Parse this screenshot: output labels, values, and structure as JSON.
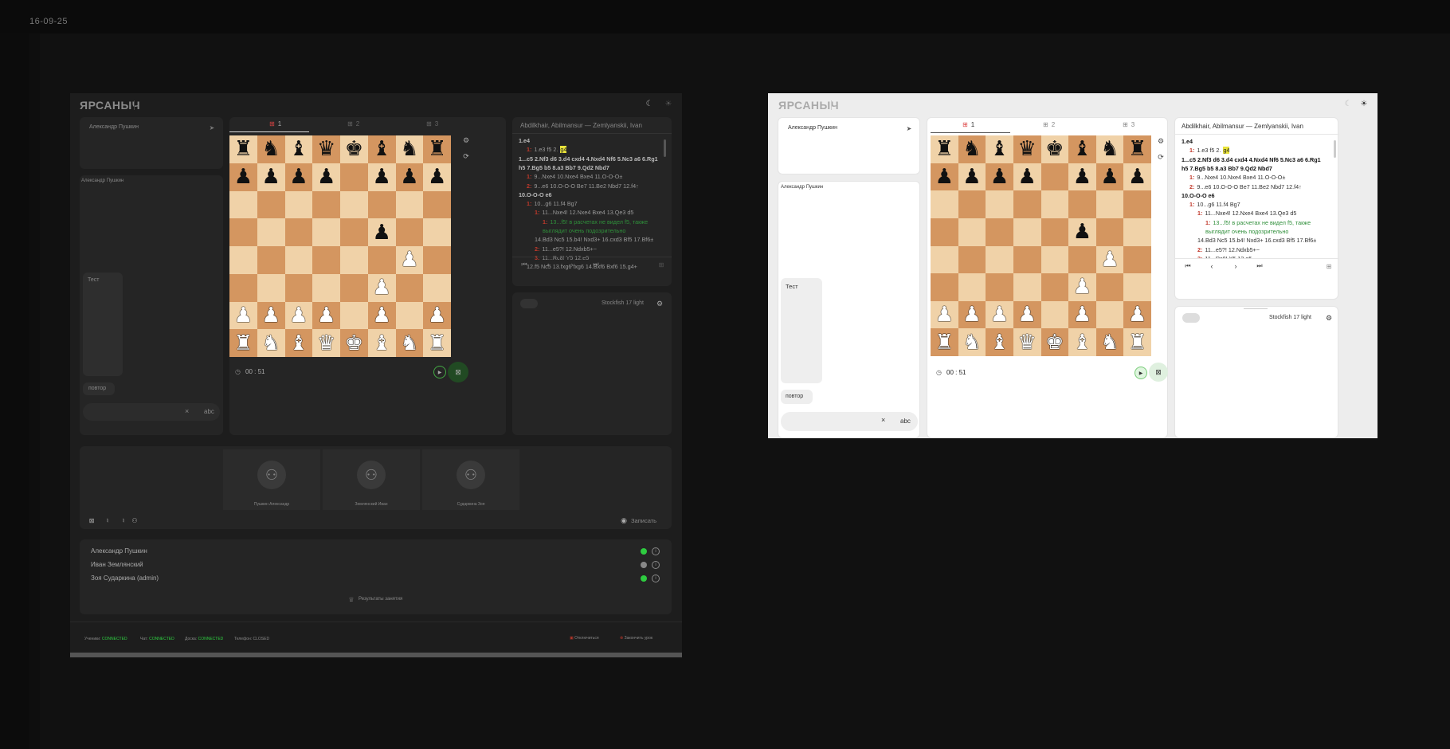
{
  "date": "16-09-25",
  "logo": "ЯРСАНЫЧ",
  "chat": {
    "sender": "Александр Пушкин",
    "author": "Александр Пушкин",
    "bubble": "Тест",
    "repeat_chip": "повтор",
    "input_placeholder": "",
    "clear_glyph": "×",
    "abc": "abc"
  },
  "board_tabs": [
    "1",
    "2",
    "3"
  ],
  "timer": "00 : 51",
  "game_title": "Abdilkhair, Abilmansur — Zemlyanskii, Ivan",
  "moves": {
    "l1": "1.e4",
    "l2a": "1:",
    "l2b": "1.e3 f5 2.",
    "l2c": "g4",
    "l3": "1...c5 2.Nf3 d6 3.d4 cxd4 4.Nxd4 Nf6 5.Nc3 a6 6.Rg1",
    "l4": "h5 7.Bg5 b5 8.a3 Bb7 9.Qd2 Nbd7",
    "l5a": "1:",
    "l5b": "9...Nxe4 10.Nxe4 Bxe4 11.O-O-O±",
    "l6a": "2:",
    "l6b": "9...e6 10.O-O-O Be7 11.Be2 Nbd7 12.f4↑",
    "l7": "10.O-O-O e6",
    "l8a": "1:",
    "l8b": "10...g6 11.f4 Bg7",
    "l9a": "1:",
    "l9b": "11...Nxe4! 12.Nxe4 Bxe4 13.Qe3 d5",
    "l10a": "1:",
    "l10b": "13...f5! в расчетах не видел f5, также",
    "l11": "выглядит очень подозрительно",
    "l12": "14.Bd3 Nc5 15.b4! Nxd3+ 16.cxd3 Bf5 17.Bf6±",
    "l13a": "2:",
    "l13b": "11...e5?! 12.Ndxb5+−",
    "l14a": "3:",
    "l14b": "11...Rc8! Y5 12.e5",
    "l15": "12.f5 Nc5 13.fxg6 fxg6 14.Bxf6 Bxf6 15.g4+"
  },
  "engine": "Stockfish 17 light",
  "participants_video": [
    "Пушкин Александр",
    "Землянский Иван",
    "Сударкина Зоя"
  ],
  "record_label": "Записать",
  "people": [
    {
      "name": "Александр Пушкин",
      "status_color": "#2ecc40"
    },
    {
      "name": "Иван Землянский",
      "status_color": "#888888"
    },
    {
      "name": "Зоя Сударкина (admin)",
      "status_color": "#2ecc40"
    }
  ],
  "results_button": "Результаты занятия",
  "status": {
    "students_label": "Ученики:",
    "students_val": "CONNECTED",
    "chat_label": "Чат:",
    "chat_val": "CONNECTED",
    "board_label": "Доска:",
    "board_val": "CONNECTED",
    "phone_label": "Телефон:",
    "phone_val": "CLOSED"
  },
  "footer": {
    "cancel": "Отключиться",
    "end_lesson": "Закончить урок"
  },
  "colors": {
    "accent_green": "#2ecc40",
    "accent_red": "#c0392b",
    "highlight": "#e9e33a"
  }
}
